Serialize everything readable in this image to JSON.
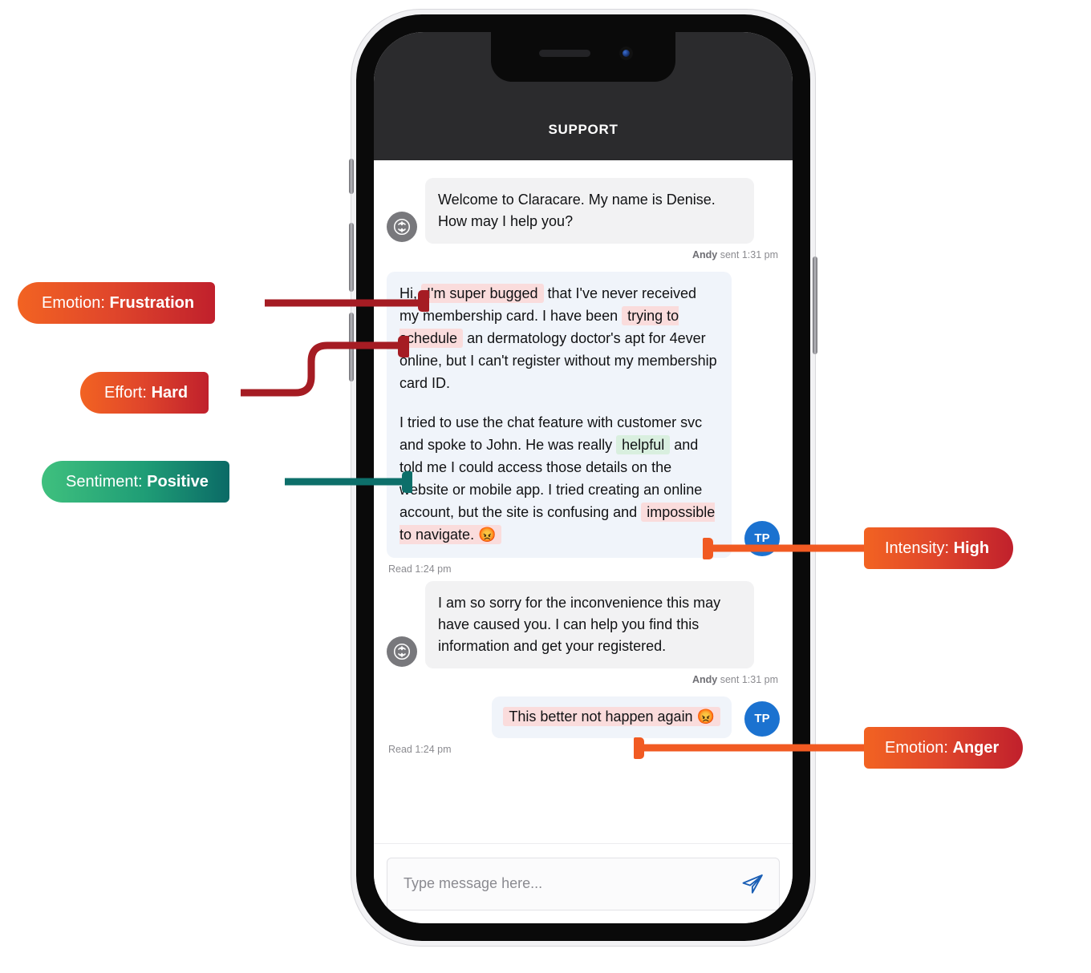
{
  "device": {
    "name": "smartphone-mockup",
    "notch_icons": [
      "speaker-slot",
      "front-camera"
    ]
  },
  "app": {
    "header_title": "SUPPORT",
    "agent_avatar_icon": "sync-arrows-icon",
    "user_avatar_initials": "TP"
  },
  "conversation": [
    {
      "id": "msg-1",
      "side": "in",
      "sender": "Andy",
      "text": "Welcome to Claracare. My name is Denise. How may I help you?",
      "meta_sender": "Andy",
      "meta_status": "sent 1:31 pm"
    },
    {
      "id": "msg-2",
      "side": "out",
      "paragraph_1": {
        "lead": "Hi, ",
        "highlight_1": "I'm super bugged",
        "middle_1": " that I've never received my membership card. I have been ",
        "highlight_2": "trying to schedule",
        "tail_1": " an dermatology doctor's apt for 4ever online, but I can't register without my membership card ID."
      },
      "paragraph_2": {
        "lead": "I tried to use the chat feature with customer svc and spoke to John. He was really ",
        "highlight_1": "helpful",
        "middle_1": " and told me I could access those details on the website or mobile app. I tried creating an online account, but the site is confusing and ",
        "highlight_2": "impossible to navigate. 😡"
      },
      "meta_status": "Read 1:24 pm"
    },
    {
      "id": "msg-3",
      "side": "in",
      "sender": "Andy",
      "text": "I am so sorry for the inconvenience this may have caused you. I can help you find this information and get your registered.",
      "meta_sender": "Andy",
      "meta_status": "sent 1:31 pm"
    },
    {
      "id": "msg-4",
      "side": "out",
      "highlight_1": "This better not happen again 😡",
      "meta_status": "Read 1:24 pm"
    }
  ],
  "composer": {
    "placeholder": "Type message here...",
    "value": "",
    "send_icon": "paper-plane-icon"
  },
  "annotations": [
    {
      "id": "ann-emotion-frustration",
      "label": "Emotion:",
      "value": "Frustration",
      "side": "left",
      "color": "#c0202c"
    },
    {
      "id": "ann-effort-hard",
      "label": "Effort:",
      "value": "Hard",
      "side": "left",
      "color": "#c0202c"
    },
    {
      "id": "ann-sentiment-positive",
      "label": "Sentiment:",
      "value": "Positive",
      "side": "left",
      "color": "#0d6f6a"
    },
    {
      "id": "ann-intensity-high",
      "label": "Intensity:",
      "value": "High",
      "side": "right",
      "color": "#f15a22"
    },
    {
      "id": "ann-emotion-anger",
      "label": "Emotion:",
      "value": "Anger",
      "side": "right",
      "color": "#f15a22"
    }
  ],
  "colors": {
    "badge_orange": "#f26322",
    "badge_red": "#c0202c",
    "badge_green_light": "#3fc07e",
    "badge_green_dark": "#0d6f6a",
    "connector_red": "#a51c23",
    "connector_teal": "#0d6f6a",
    "connector_orange": "#f15a22",
    "highlight_red": "#fadcdc",
    "highlight_green": "#d9efdf",
    "user_avatar_blue": "#1b72d0",
    "header_dark": "#2b2b2d"
  }
}
